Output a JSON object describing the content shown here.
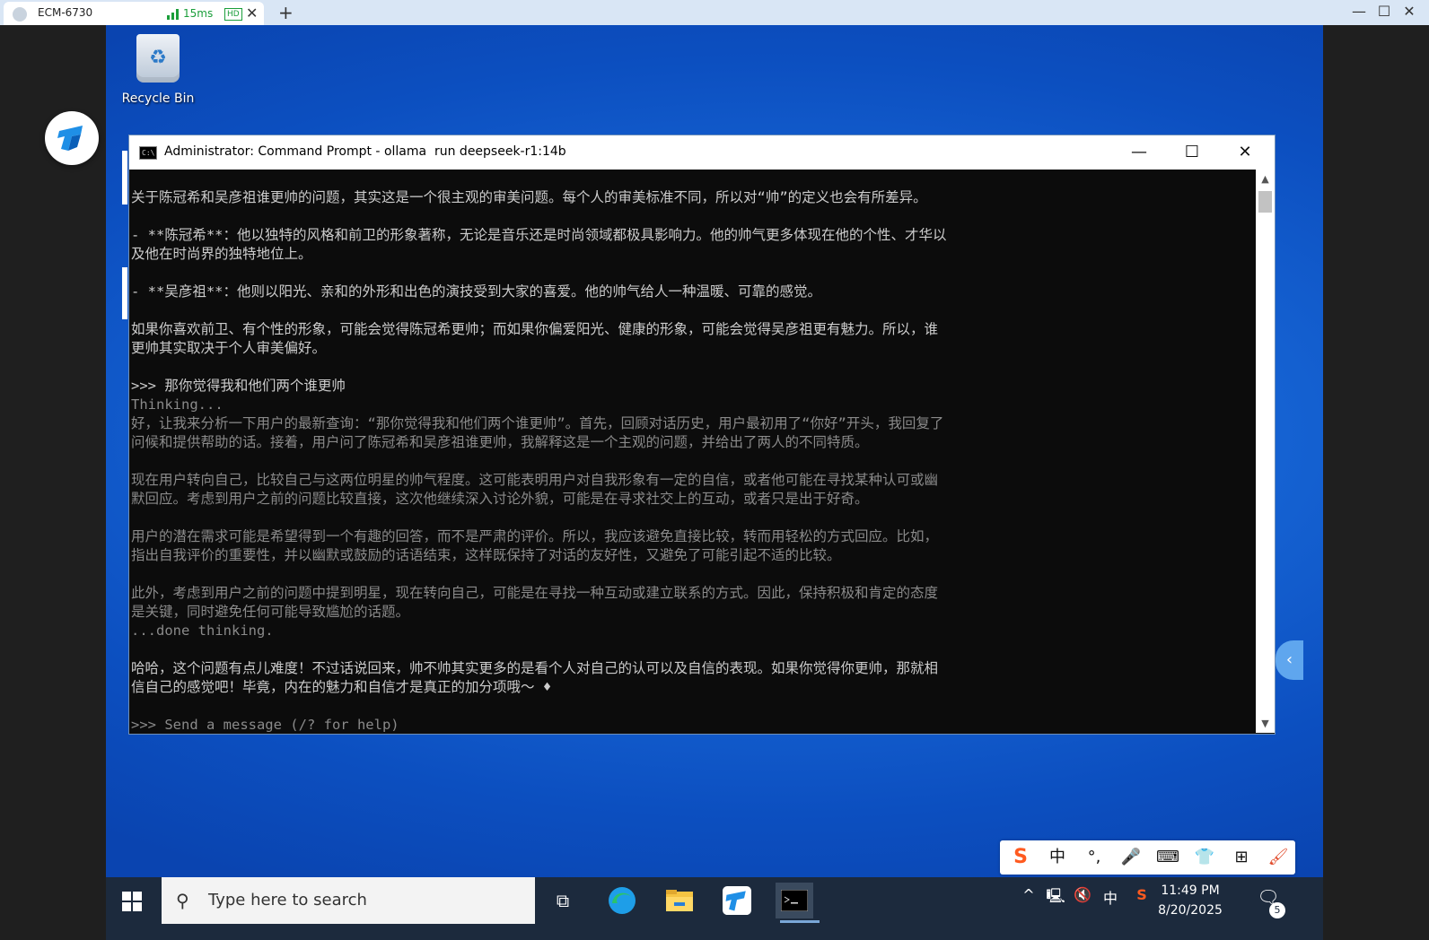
{
  "remote_window": {
    "tab_title": "ECM-6730",
    "latency": "15ms",
    "quality_badge": "HD",
    "close_tab": "✕",
    "new_tab": "+",
    "controls": {
      "minimize": "—",
      "maximize": "☐",
      "close": "✕"
    }
  },
  "desktop": {
    "recycle_bin_label": "Recycle Bin"
  },
  "cmd": {
    "title": "Administrator: Command Prompt - ollama  run deepseek-r1:14b",
    "controls": {
      "minimize": "—",
      "maximize": "☐",
      "close": "✕"
    },
    "lines": [
      {
        "text": "关于陈冠希和吴彦祖谁更帅的问题，其实这是一个很主观的审美问题。每个人的审美标准不同，所以对“帅”的定义也会有所差异。",
        "style": "normal"
      },
      {
        "text": "",
        "style": "normal"
      },
      {
        "text": "- **陈冠希**：他以独特的风格和前卫的形象著称，无论是音乐还是时尚领域都极具影响力。他的帅气更多体现在他的个性、才华以",
        "style": "normal"
      },
      {
        "text": "及他在时尚界的独特地位上。",
        "style": "normal"
      },
      {
        "text": "",
        "style": "normal"
      },
      {
        "text": "- **吴彦祖**：他则以阳光、亲和的外形和出色的演技受到大家的喜爱。他的帅气给人一种温暖、可靠的感觉。",
        "style": "normal"
      },
      {
        "text": "",
        "style": "normal"
      },
      {
        "text": "如果你喜欢前卫、有个性的形象，可能会觉得陈冠希更帅；而如果你偏爱阳光、健康的形象，可能会觉得吴彦祖更有魅力。所以，谁",
        "style": "normal"
      },
      {
        "text": "更帅其实取决于个人审美偏好。",
        "style": "normal"
      },
      {
        "text": "",
        "style": "normal"
      },
      {
        "text": ">>> 那你觉得我和他们两个谁更帅",
        "style": "normal"
      },
      {
        "text": "Thinking...",
        "style": "gray"
      },
      {
        "text": "好，让我来分析一下用户的最新查询：“那你觉得我和他们两个谁更帅”。首先，回顾对话历史，用户最初用了“你好”开头，我回复了",
        "style": "gray"
      },
      {
        "text": "问候和提供帮助的话。接着，用户问了陈冠希和吴彦祖谁更帅，我解释这是一个主观的问题，并给出了两人的不同特质。",
        "style": "gray"
      },
      {
        "text": "",
        "style": "gray"
      },
      {
        "text": "现在用户转向自己，比较自己与这两位明星的帅气程度。这可能表明用户对自我形象有一定的自信，或者他可能在寻找某种认可或幽",
        "style": "gray"
      },
      {
        "text": "默回应。考虑到用户之前的问题比较直接，这次他继续深入讨论外貌，可能是在寻求社交上的互动，或者只是出于好奇。",
        "style": "gray"
      },
      {
        "text": "",
        "style": "gray"
      },
      {
        "text": "用户的潜在需求可能是希望得到一个有趣的回答，而不是严肃的评价。所以，我应该避免直接比较，转而用轻松的方式回应。比如，",
        "style": "gray"
      },
      {
        "text": "指出自我评价的重要性，并以幽默或鼓励的话语结束，这样既保持了对话的友好性，又避免了可能引起不适的比较。",
        "style": "gray"
      },
      {
        "text": "",
        "style": "gray"
      },
      {
        "text": "此外，考虑到用户之前的问题中提到明星，现在转向自己，可能是在寻找一种互动或建立联系的方式。因此，保持积极和肯定的态度",
        "style": "gray"
      },
      {
        "text": "是关键，同时避免任何可能导致尴尬的话题。",
        "style": "gray"
      },
      {
        "text": "...done thinking.",
        "style": "gray"
      },
      {
        "text": "",
        "style": "normal"
      },
      {
        "text": "哈哈，这个问题有点儿难度！不过话说回来，帅不帅其实更多的是看个人对自己的认可以及自信的表现。如果你觉得你更帅，那就相",
        "style": "normal"
      },
      {
        "text": "信自己的感觉吧！毕竟，内在的魅力和自信才是真正的加分项哦～ ♦",
        "style": "normal"
      },
      {
        "text": "",
        "style": "normal"
      },
      {
        "text": ">>> Send a message (/? for help)",
        "style": "gray"
      }
    ]
  },
  "ime": {
    "items": [
      "S",
      "中",
      "°,",
      "🎤",
      "⌨",
      "👕",
      "⊞",
      "🖌"
    ]
  },
  "taskbar": {
    "search_placeholder": "Type here to search",
    "tray": {
      "chevron": "^",
      "ime_mode": "中",
      "time": "11:49 PM",
      "date": "8/20/2025",
      "notification_count": "5"
    }
  }
}
